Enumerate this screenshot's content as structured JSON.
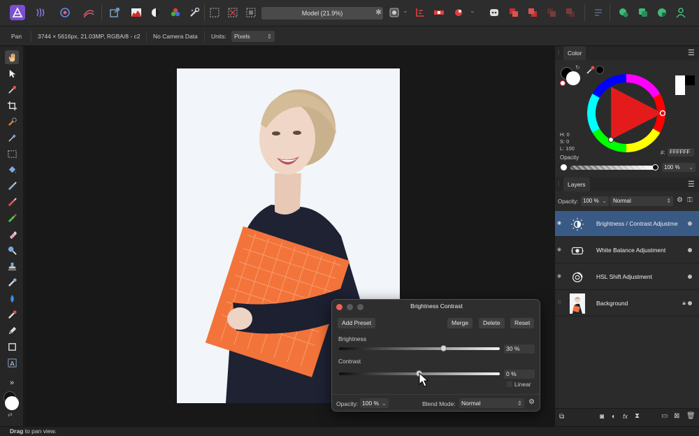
{
  "toolbar": {
    "document_name": "Model (21.9%)"
  },
  "context_bar": {
    "tool_name": "Pan",
    "image_info": "3744 × 5616px, 21.03MP, RGBA/8 - c2",
    "camera_data": "No Camera Data",
    "units_label": "Units:",
    "units_value": "Pixels"
  },
  "color_panel": {
    "tab_label": "Color",
    "h_label": "H: 0",
    "s_label": "S: 0",
    "l_label": "L: 100",
    "hex_label": "#:",
    "hex_value": "FFFFFF",
    "opacity_label": "Opacity",
    "opacity_value": "100 %",
    "opacity_fraction": 1.0
  },
  "layers_panel": {
    "tab_label": "Layers",
    "opacity_label": "Opacity:",
    "opacity_value": "100 %",
    "blend_mode": "Normal",
    "layers": [
      {
        "name": "Brightness / Contrast Adjustme",
        "icon": "brightness-icon",
        "selected": true
      },
      {
        "name": "White Balance Adjustment",
        "icon": "white-balance-icon",
        "selected": false
      },
      {
        "name": "HSL Shift Adjustment",
        "icon": "hsl-icon",
        "selected": false
      },
      {
        "name": "Background",
        "icon": "photo-thumbnail",
        "selected": false
      }
    ]
  },
  "dialog": {
    "title": "Brightness Contrast",
    "add_preset_label": "Add Preset",
    "merge_label": "Merge",
    "delete_label": "Delete",
    "reset_label": "Reset",
    "brightness_label": "Brightness",
    "brightness_value": "30 %",
    "brightness_fraction": 0.65,
    "contrast_label": "Contrast",
    "contrast_value": "0 %",
    "contrast_fraction": 0.5,
    "linear_label": "Linear",
    "opacity_label": "Opacity:",
    "opacity_value": "100 %",
    "blend_mode_label": "Blend Mode:",
    "blend_mode_value": "Normal"
  },
  "status": {
    "bold": "Drag",
    "text": " to pan view."
  },
  "colors": {
    "accent_selected": "#3a5a86",
    "primary_color": "#ffffff",
    "close_red": "#ed5f57"
  }
}
